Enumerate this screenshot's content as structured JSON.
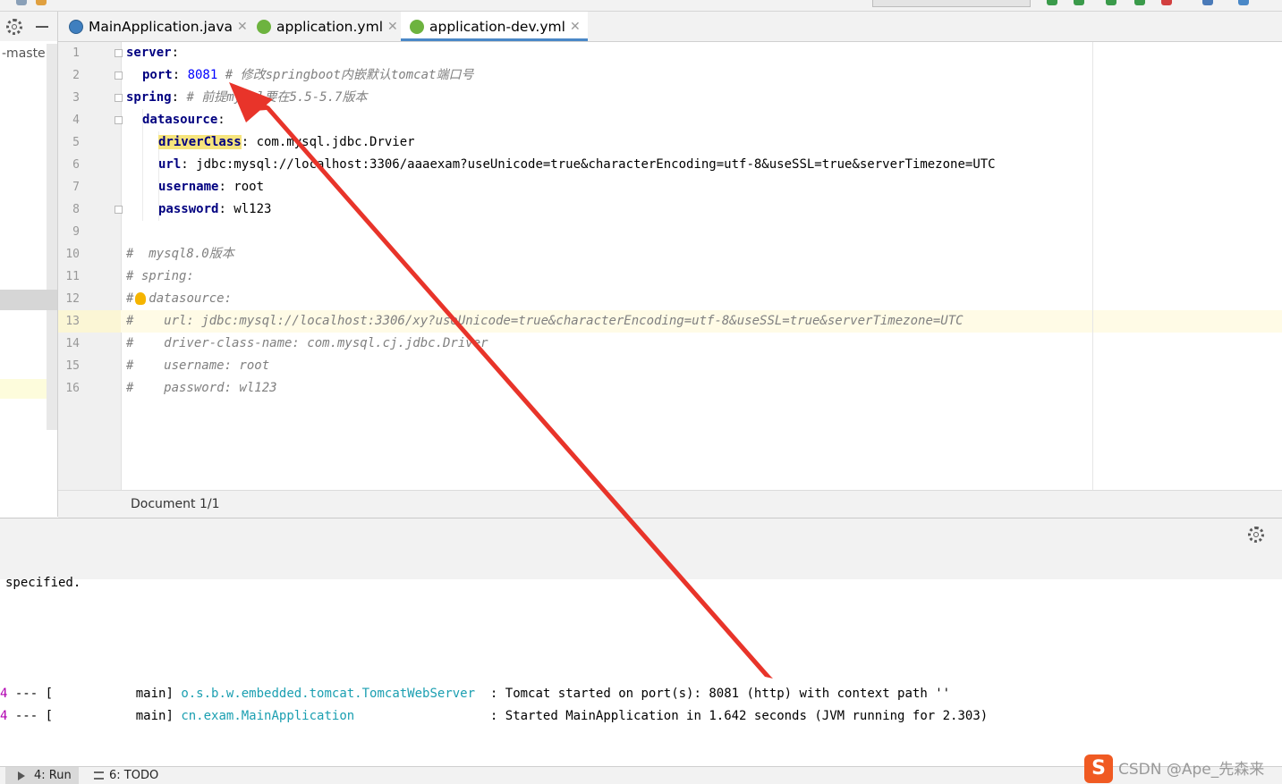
{
  "project": {
    "label": "-maste"
  },
  "tabs": [
    {
      "label": "MainApplication.java",
      "icon": "java-class-icon",
      "active": false
    },
    {
      "label": "application.yml",
      "icon": "yaml-spring-icon",
      "active": false
    },
    {
      "label": "application-dev.yml",
      "icon": "yaml-spring-icon",
      "active": true
    }
  ],
  "editor": {
    "line_numbers": [
      "1",
      "2",
      "3",
      "4",
      "5",
      "6",
      "7",
      "8",
      "9",
      "10",
      "11",
      "12",
      "13",
      "14",
      "15",
      "16"
    ],
    "lines": [
      {
        "key": "server",
        "rest": ":"
      },
      {
        "key": "port",
        "sep": ": ",
        "value": "8081",
        "comment": " # 修改springboot内嵌默认tomcat端口号"
      },
      {
        "key": "spring",
        "sep": ": ",
        "comment": "# 前提mysql要在5.5-5.7版本"
      },
      {
        "key": "datasource",
        "rest": ":"
      },
      {
        "key": "driverClass",
        "sep": ": ",
        "value": "com.mysql.jdbc.Drvier"
      },
      {
        "key": "url",
        "sep": ": ",
        "value": "jdbc:mysql://localhost:3306/aaaexam?useUnicode=true&characterEncoding=utf-8&useSSL=true&serverTimezone=UTC"
      },
      {
        "key": "username",
        "sep": ": ",
        "value": "root"
      },
      {
        "key": "password",
        "sep": ": ",
        "value": "wl123"
      },
      {
        "text": ""
      },
      {
        "comment": "#  mysql8.0版本"
      },
      {
        "comment": "# spring:"
      },
      {
        "comment_hash": "#",
        "comment": "  datasource:"
      },
      {
        "comment": "#    url: jdbc:mysql://localhost:3306/xy?useUnicode=true&characterEncoding=utf-8&useSSL=true&serverTimezone=UTC"
      },
      {
        "comment": "#    driver-class-name: com.mysql.cj.jdbc.Driver"
      },
      {
        "comment": "#    username: root"
      },
      {
        "comment": "#    password: wl123"
      }
    ]
  },
  "breadcrumb": {
    "text": "Document 1/1"
  },
  "console": {
    "partial_line": "specified.",
    "log_lines": [
      {
        "pid": "4",
        "dashes": " --- [",
        "thread": "           main]",
        "logger": "o.s.b.w.embedded.tomcat.TomcatWebServer",
        "message": "  : Tomcat started on port(s): 8081 (http) with context path ''"
      },
      {
        "pid": "4",
        "dashes": " --- [",
        "thread": "           main]",
        "logger": "cn.exam.MainApplication                ",
        "message": "  : Started MainApplication in 1.642 seconds (JVM running for 2.303)"
      }
    ]
  },
  "bottom_bar": {
    "run_label": "4: Run",
    "todo_label": "6: TODO"
  },
  "watermark": {
    "logo": "S",
    "text": "CSDN @Ape_先森来"
  },
  "colors": {
    "arrow": "#e8342a",
    "accent": "#4a88c7",
    "keyword": "#000080",
    "number": "#0000ff",
    "comment": "#808080",
    "logger": "#1b9fb1"
  }
}
